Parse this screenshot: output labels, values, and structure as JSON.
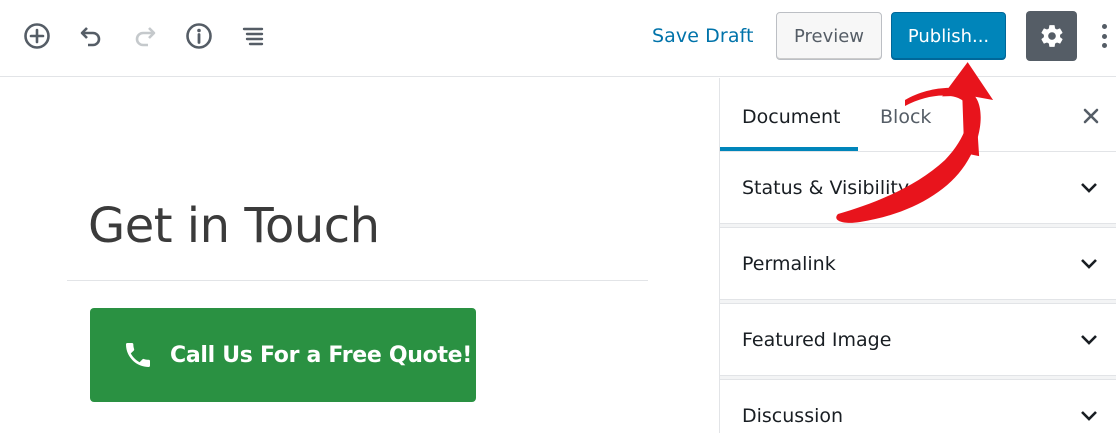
{
  "toolbar": {
    "icons": [
      "add-block-icon",
      "undo-icon",
      "redo-icon",
      "info-icon",
      "block-navigation-icon"
    ],
    "save_draft_label": "Save Draft",
    "preview_label": "Preview",
    "publish_label": "Publish...",
    "settings_icon": "gear-icon",
    "more_icon": "more-vertical-icon"
  },
  "editor": {
    "title": "Get in Touch",
    "button": {
      "icon": "phone-icon",
      "label": "Call Us For a Free Quote!",
      "color": "#2a9142"
    }
  },
  "sidebar": {
    "tabs": [
      {
        "label": "Document",
        "active": true
      },
      {
        "label": "Block",
        "active": false
      }
    ],
    "close_icon": "close-icon",
    "panels": [
      {
        "label": "Status & Visibility"
      },
      {
        "label": "Permalink"
      },
      {
        "label": "Featured Image"
      },
      {
        "label": "Discussion"
      }
    ]
  },
  "colors": {
    "accent": "#0085ba",
    "link": "#0073aa",
    "annotation": "#e8141c"
  }
}
